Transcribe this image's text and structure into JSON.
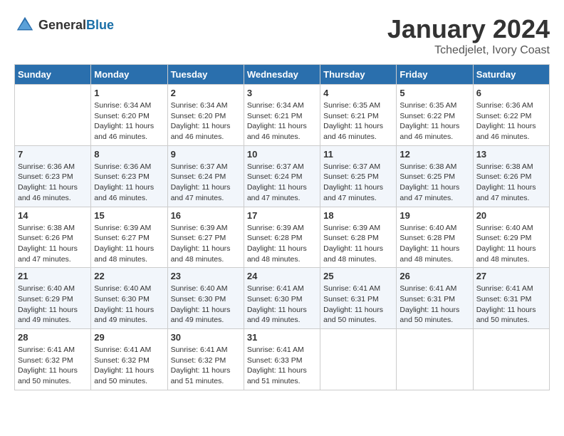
{
  "header": {
    "logo_general": "General",
    "logo_blue": "Blue",
    "month_title": "January 2024",
    "location": "Tchedjelet, Ivory Coast"
  },
  "days_of_week": [
    "Sunday",
    "Monday",
    "Tuesday",
    "Wednesday",
    "Thursday",
    "Friday",
    "Saturday"
  ],
  "weeks": [
    [
      {
        "day": "",
        "sunrise": "",
        "sunset": "",
        "daylight": ""
      },
      {
        "day": "1",
        "sunrise": "Sunrise: 6:34 AM",
        "sunset": "Sunset: 6:20 PM",
        "daylight": "Daylight: 11 hours and 46 minutes."
      },
      {
        "day": "2",
        "sunrise": "Sunrise: 6:34 AM",
        "sunset": "Sunset: 6:20 PM",
        "daylight": "Daylight: 11 hours and 46 minutes."
      },
      {
        "day": "3",
        "sunrise": "Sunrise: 6:34 AM",
        "sunset": "Sunset: 6:21 PM",
        "daylight": "Daylight: 11 hours and 46 minutes."
      },
      {
        "day": "4",
        "sunrise": "Sunrise: 6:35 AM",
        "sunset": "Sunset: 6:21 PM",
        "daylight": "Daylight: 11 hours and 46 minutes."
      },
      {
        "day": "5",
        "sunrise": "Sunrise: 6:35 AM",
        "sunset": "Sunset: 6:22 PM",
        "daylight": "Daylight: 11 hours and 46 minutes."
      },
      {
        "day": "6",
        "sunrise": "Sunrise: 6:36 AM",
        "sunset": "Sunset: 6:22 PM",
        "daylight": "Daylight: 11 hours and 46 minutes."
      }
    ],
    [
      {
        "day": "7",
        "sunrise": "Sunrise: 6:36 AM",
        "sunset": "Sunset: 6:23 PM",
        "daylight": "Daylight: 11 hours and 46 minutes."
      },
      {
        "day": "8",
        "sunrise": "Sunrise: 6:36 AM",
        "sunset": "Sunset: 6:23 PM",
        "daylight": "Daylight: 11 hours and 46 minutes."
      },
      {
        "day": "9",
        "sunrise": "Sunrise: 6:37 AM",
        "sunset": "Sunset: 6:24 PM",
        "daylight": "Daylight: 11 hours and 47 minutes."
      },
      {
        "day": "10",
        "sunrise": "Sunrise: 6:37 AM",
        "sunset": "Sunset: 6:24 PM",
        "daylight": "Daylight: 11 hours and 47 minutes."
      },
      {
        "day": "11",
        "sunrise": "Sunrise: 6:37 AM",
        "sunset": "Sunset: 6:25 PM",
        "daylight": "Daylight: 11 hours and 47 minutes."
      },
      {
        "day": "12",
        "sunrise": "Sunrise: 6:38 AM",
        "sunset": "Sunset: 6:25 PM",
        "daylight": "Daylight: 11 hours and 47 minutes."
      },
      {
        "day": "13",
        "sunrise": "Sunrise: 6:38 AM",
        "sunset": "Sunset: 6:26 PM",
        "daylight": "Daylight: 11 hours and 47 minutes."
      }
    ],
    [
      {
        "day": "14",
        "sunrise": "Sunrise: 6:38 AM",
        "sunset": "Sunset: 6:26 PM",
        "daylight": "Daylight: 11 hours and 47 minutes."
      },
      {
        "day": "15",
        "sunrise": "Sunrise: 6:39 AM",
        "sunset": "Sunset: 6:27 PM",
        "daylight": "Daylight: 11 hours and 48 minutes."
      },
      {
        "day": "16",
        "sunrise": "Sunrise: 6:39 AM",
        "sunset": "Sunset: 6:27 PM",
        "daylight": "Daylight: 11 hours and 48 minutes."
      },
      {
        "day": "17",
        "sunrise": "Sunrise: 6:39 AM",
        "sunset": "Sunset: 6:28 PM",
        "daylight": "Daylight: 11 hours and 48 minutes."
      },
      {
        "day": "18",
        "sunrise": "Sunrise: 6:39 AM",
        "sunset": "Sunset: 6:28 PM",
        "daylight": "Daylight: 11 hours and 48 minutes."
      },
      {
        "day": "19",
        "sunrise": "Sunrise: 6:40 AM",
        "sunset": "Sunset: 6:28 PM",
        "daylight": "Daylight: 11 hours and 48 minutes."
      },
      {
        "day": "20",
        "sunrise": "Sunrise: 6:40 AM",
        "sunset": "Sunset: 6:29 PM",
        "daylight": "Daylight: 11 hours and 48 minutes."
      }
    ],
    [
      {
        "day": "21",
        "sunrise": "Sunrise: 6:40 AM",
        "sunset": "Sunset: 6:29 PM",
        "daylight": "Daylight: 11 hours and 49 minutes."
      },
      {
        "day": "22",
        "sunrise": "Sunrise: 6:40 AM",
        "sunset": "Sunset: 6:30 PM",
        "daylight": "Daylight: 11 hours and 49 minutes."
      },
      {
        "day": "23",
        "sunrise": "Sunrise: 6:40 AM",
        "sunset": "Sunset: 6:30 PM",
        "daylight": "Daylight: 11 hours and 49 minutes."
      },
      {
        "day": "24",
        "sunrise": "Sunrise: 6:41 AM",
        "sunset": "Sunset: 6:30 PM",
        "daylight": "Daylight: 11 hours and 49 minutes."
      },
      {
        "day": "25",
        "sunrise": "Sunrise: 6:41 AM",
        "sunset": "Sunset: 6:31 PM",
        "daylight": "Daylight: 11 hours and 50 minutes."
      },
      {
        "day": "26",
        "sunrise": "Sunrise: 6:41 AM",
        "sunset": "Sunset: 6:31 PM",
        "daylight": "Daylight: 11 hours and 50 minutes."
      },
      {
        "day": "27",
        "sunrise": "Sunrise: 6:41 AM",
        "sunset": "Sunset: 6:31 PM",
        "daylight": "Daylight: 11 hours and 50 minutes."
      }
    ],
    [
      {
        "day": "28",
        "sunrise": "Sunrise: 6:41 AM",
        "sunset": "Sunset: 6:32 PM",
        "daylight": "Daylight: 11 hours and 50 minutes."
      },
      {
        "day": "29",
        "sunrise": "Sunrise: 6:41 AM",
        "sunset": "Sunset: 6:32 PM",
        "daylight": "Daylight: 11 hours and 50 minutes."
      },
      {
        "day": "30",
        "sunrise": "Sunrise: 6:41 AM",
        "sunset": "Sunset: 6:32 PM",
        "daylight": "Daylight: 11 hours and 51 minutes."
      },
      {
        "day": "31",
        "sunrise": "Sunrise: 6:41 AM",
        "sunset": "Sunset: 6:33 PM",
        "daylight": "Daylight: 11 hours and 51 minutes."
      },
      {
        "day": "",
        "sunrise": "",
        "sunset": "",
        "daylight": ""
      },
      {
        "day": "",
        "sunrise": "",
        "sunset": "",
        "daylight": ""
      },
      {
        "day": "",
        "sunrise": "",
        "sunset": "",
        "daylight": ""
      }
    ]
  ]
}
